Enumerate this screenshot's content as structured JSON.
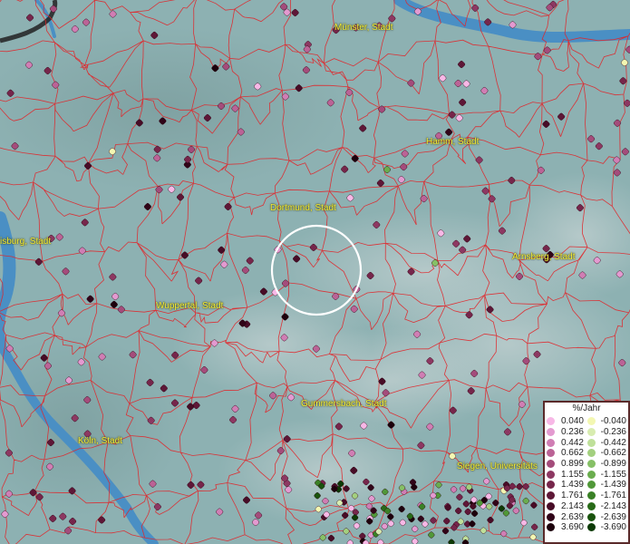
{
  "map": {
    "cities": [
      {
        "name": "Münster, Stadt"
      },
      {
        "name": "Hamm, Stadt"
      },
      {
        "name": "Dortmund, Stadt"
      },
      {
        "name": "Arnsberg, Stadt"
      },
      {
        "name": "isburg, Stadt"
      },
      {
        "name": "Wuppertal, Stadt"
      },
      {
        "name": "Gummersbach, Stadt"
      },
      {
        "name": "Köln, Stadt"
      },
      {
        "name": "Siegen, Universitäts"
      }
    ],
    "colors": {
      "water": "#4a8fc4",
      "boundary": "#e0262a",
      "selection_ring": "#ffffff",
      "label": "#f4ee3a"
    }
  },
  "legend": {
    "title": "%/Jahr",
    "rows": [
      {
        "pos": "0.040",
        "pos_color": "#f7b8e6",
        "neg": "-0.040",
        "neg_color": "#f3f7b2"
      },
      {
        "pos": "0.236",
        "pos_color": "#e39ad0",
        "neg": "-0.236",
        "neg_color": "#d8ecb0"
      },
      {
        "pos": "0.442",
        "pos_color": "#d07eb4",
        "neg": "-0.442",
        "neg_color": "#bfe09a"
      },
      {
        "pos": "0.662",
        "pos_color": "#bb6396",
        "neg": "-0.662",
        "neg_color": "#a3d07f"
      },
      {
        "pos": "0.899",
        "pos_color": "#a44c7b",
        "neg": "-0.899",
        "neg_color": "#86c066"
      },
      {
        "pos": "1.155",
        "pos_color": "#8d3862",
        "neg": "-1.155",
        "neg_color": "#6aad4e"
      },
      {
        "pos": "1.439",
        "pos_color": "#76264b",
        "neg": "-1.439",
        "neg_color": "#509838"
      },
      {
        "pos": "1.761",
        "pos_color": "#5e1737",
        "neg": "-1.761",
        "neg_color": "#3a8126"
      },
      {
        "pos": "2.143",
        "pos_color": "#470c26",
        "neg": "-2.143",
        "neg_color": "#286a18"
      },
      {
        "pos": "2.639",
        "pos_color": "#300418",
        "neg": "-2.639",
        "neg_color": "#19530d"
      },
      {
        "pos": "3.690",
        "pos_color": "#1c000c",
        "neg": "-3.690",
        "neg_color": "#0c3a05"
      }
    ]
  }
}
